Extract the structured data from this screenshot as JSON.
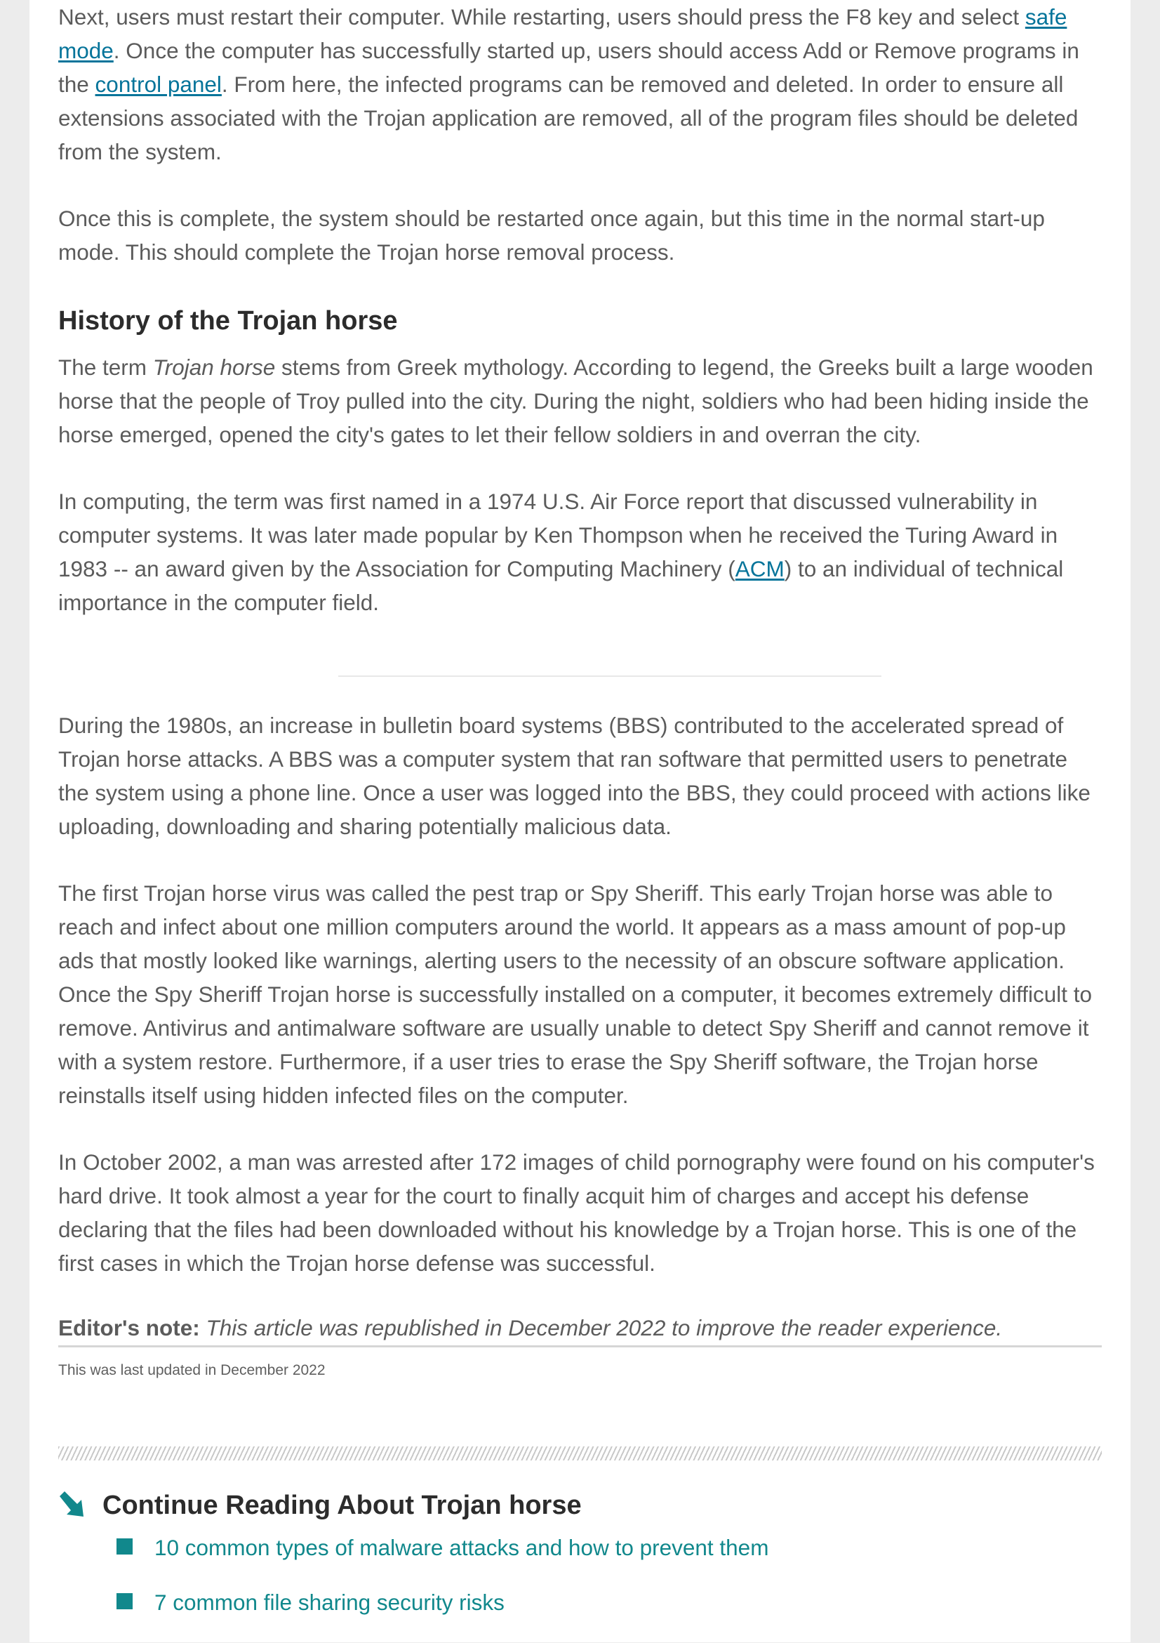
{
  "article": {
    "p1": {
      "t1": "Next, users must restart their computer. While restarting, users should press the F8 key and select ",
      "link1": "safe mode",
      "t2": ". Once the computer has successfully started up, users should access Add or Remove programs in the ",
      "link2": "control panel",
      "t3": ". From here, the infected programs can be removed and deleted. In order to ensure all extensions associated with the Trojan application are removed, all of the program files should be deleted from the system."
    },
    "p2": "Once this is complete, the system should be restarted once again, but this time in the normal start-up mode. This should complete the Trojan horse removal process.",
    "history_heading": "History of the Trojan horse",
    "p3": {
      "t1": "The term ",
      "em": "Trojan horse",
      "t2": " stems from Greek mythology. According to legend, the Greeks built a large wooden horse that the people of Troy pulled into the city. During the night, soldiers who had been hiding inside the horse emerged, opened the city's gates to let their fellow soldiers in and overran the city."
    },
    "p4": {
      "t1": "In computing, the term was first named in a 1974 U.S. Air Force report that discussed vulnerability in computer systems. It was later made popular by Ken Thompson when he received the Turing Award in 1983 -- an award given by the Association for Computing Machinery (",
      "link": "ACM",
      "t2": ") to an individual of technical importance in the computer field."
    },
    "p5": "During the 1980s, an increase in bulletin board systems (BBS) contributed to the accelerated spread of Trojan horse attacks. A BBS was a computer system that ran software that permitted users to penetrate the system using a phone line. Once a user was logged into the BBS, they could proceed with actions like uploading, downloading and sharing potentially malicious data.",
    "p6": "The first Trojan horse virus was called the pest trap or Spy Sheriff. This early Trojan horse was able to reach and infect about one million computers around the world. It appears as a mass amount of pop-up ads that mostly looked like warnings, alerting users to the necessity of an obscure software application. Once the Spy Sheriff Trojan horse is successfully installed on a computer, it becomes extremely difficult to remove. Antivirus and antimalware software are usually unable to detect Spy Sheriff and cannot remove it with a system restore. Furthermore, if a user tries to erase the Spy Sheriff software, the Trojan horse reinstalls itself using hidden infected files on the computer.",
    "p7": "In October 2002, a man was arrested after 172 images of child pornography were found on his computer's hard drive. It took almost a year for the court to finally acquit him of charges and accept his defense declaring that the files had been downloaded without his knowledge by a Trojan horse. This is one of the first cases in which the Trojan horse defense was successful.",
    "editor_note": {
      "label": "Editor's note:",
      "text": "This article was republished in December 2022 to improve the reader experience."
    },
    "last_updated": "This was last updated in December 2022"
  },
  "continue_reading": {
    "title": "Continue Reading About Trojan horse",
    "items": [
      "10 common types of malware attacks and how to prevent them",
      "7 common file sharing security risks"
    ]
  },
  "colors": {
    "link": "#05749a",
    "accent_teal": "#11888c",
    "body_text": "#5b5b5b",
    "heading_text": "#2c2c2c"
  },
  "icons": {
    "continue_reading": "arrow-down-right-icon",
    "list_bullet": "square-bullet"
  }
}
